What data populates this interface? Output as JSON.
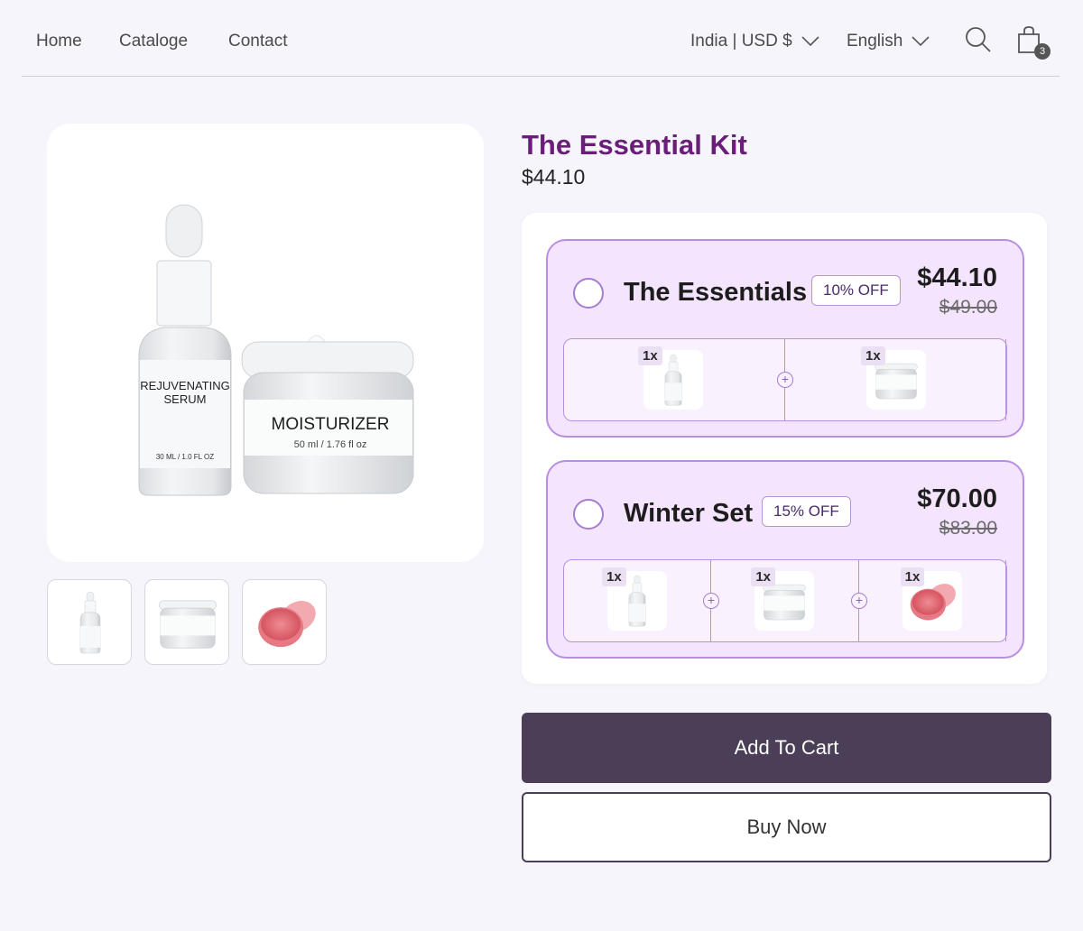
{
  "nav": {
    "items": [
      "Home",
      "Cataloge",
      "Contact"
    ]
  },
  "header": {
    "region_label": "India | USD $",
    "language_label": "English",
    "cart_count": "3",
    "icons": [
      "search-icon",
      "shopping-bag-icon",
      "chevron-down-icon"
    ]
  },
  "product": {
    "title": "The Essential Kit",
    "price": "$44.10",
    "image_texts": {
      "serum_label_1": "REJUVENATING",
      "serum_label_2": "SERUM",
      "serum_volume": "30 ML / 1.0 FL OZ",
      "jar_label": "MOISTURIZER",
      "jar_volume": "50 ml / 1.76 fl oz"
    }
  },
  "offers": [
    {
      "name": "The Essentials",
      "badge": "10% OFF",
      "price": "$44.10",
      "old_price": "$49.00",
      "items": [
        {
          "qty": "1x",
          "product": "serum"
        },
        {
          "qty": "1x",
          "product": "moisturizer"
        }
      ]
    },
    {
      "name": "Winter Set",
      "badge": "15% OFF",
      "price": "$70.00",
      "old_price": "$83.00",
      "items": [
        {
          "qty": "1x",
          "product": "serum"
        },
        {
          "qty": "1x",
          "product": "moisturizer"
        },
        {
          "qty": "1x",
          "product": "scrub"
        }
      ]
    }
  ],
  "actions": {
    "add_to_cart": "Add To Cart",
    "buy_now": "Buy Now"
  },
  "colors": {
    "title": "#6a1e7a",
    "offer_bg": "#f4e4fd",
    "offer_border": "#b88ee3",
    "primary_button": "#4a3f57",
    "page_bg": "#f7f5fc"
  }
}
